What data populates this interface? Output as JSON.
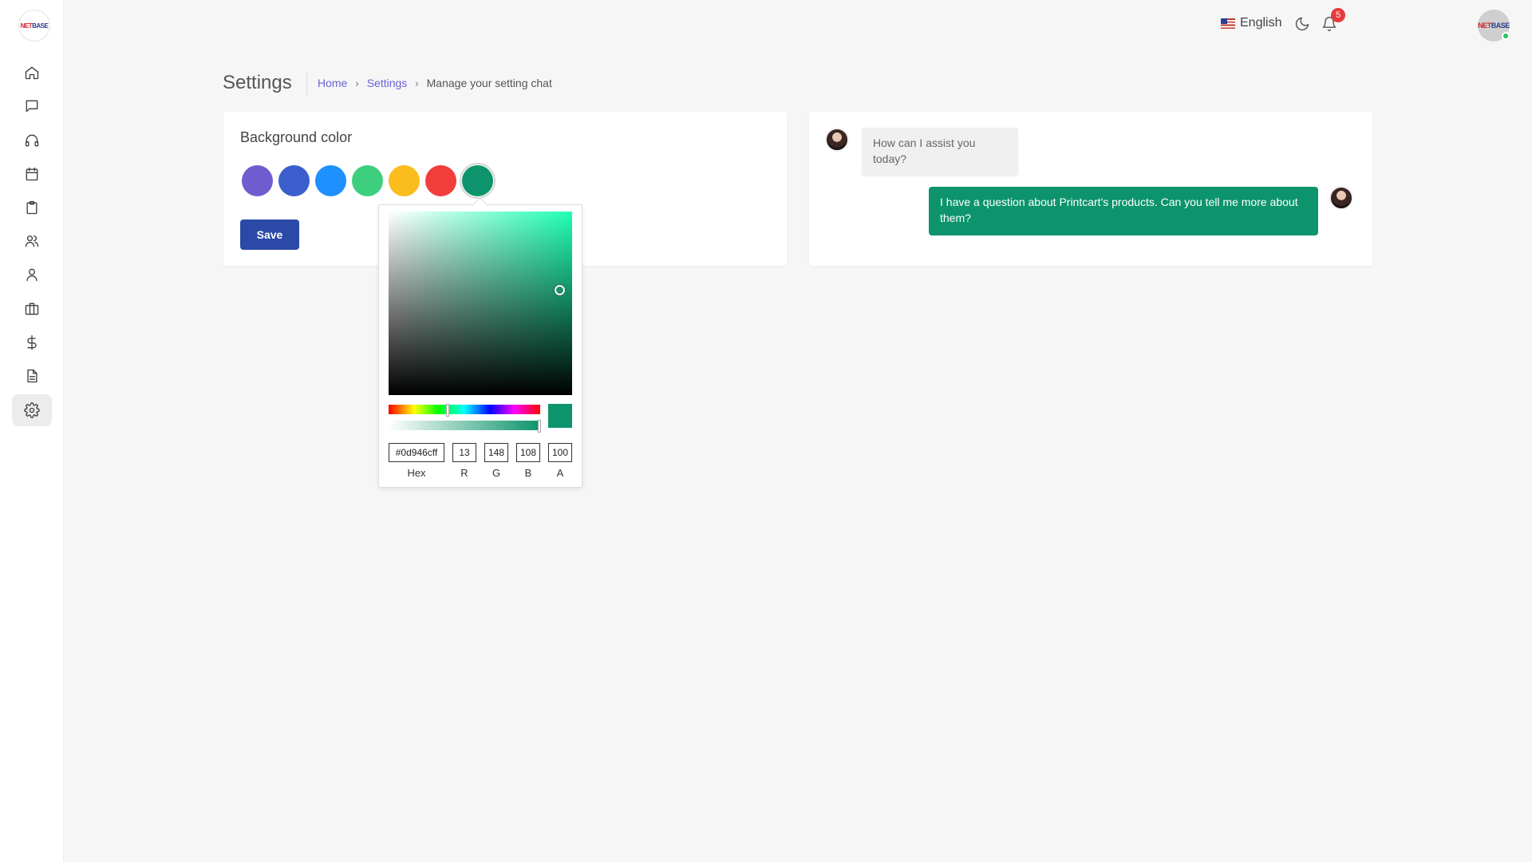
{
  "brand": {
    "logo_part1": "NET",
    "logo_part2": "BASE"
  },
  "topbar": {
    "language": "English",
    "notification_count": "5"
  },
  "header": {
    "title": "Settings",
    "breadcrumb": {
      "home": "Home",
      "settings": "Settings",
      "current": "Manage your setting chat"
    }
  },
  "sidebar": {
    "items": [
      {
        "icon": "home-icon"
      },
      {
        "icon": "chat-icon"
      },
      {
        "icon": "headphones-icon"
      },
      {
        "icon": "calendar-icon"
      },
      {
        "icon": "clipboard-icon"
      },
      {
        "icon": "users-icon"
      },
      {
        "icon": "user-icon"
      },
      {
        "icon": "briefcase-icon"
      },
      {
        "icon": "dollar-icon"
      },
      {
        "icon": "document-icon"
      },
      {
        "icon": "gear-icon",
        "active": true
      }
    ]
  },
  "background_color": {
    "title": "Background color",
    "swatches": [
      "#6f5dcf",
      "#3a5fcd",
      "#1e90ff",
      "#3ecf7e",
      "#fbbc1d",
      "#f23d3d",
      "#0d946c"
    ],
    "selected_index": 6,
    "save_label": "Save"
  },
  "color_picker": {
    "hex": "#0d946cff",
    "r": "13",
    "g": "148",
    "b": "108",
    "a": "100",
    "labels": {
      "hex": "Hex",
      "r": "R",
      "g": "G",
      "b": "B",
      "a": "A"
    }
  },
  "chat_preview": {
    "incoming": "How can I assist you today?",
    "outgoing": "I have a question about Printcart's products. Can you tell me more about them?"
  },
  "colors": {
    "accent": "#0d946c",
    "primary_button": "#2b4aa8",
    "link": "#6b62d6"
  }
}
